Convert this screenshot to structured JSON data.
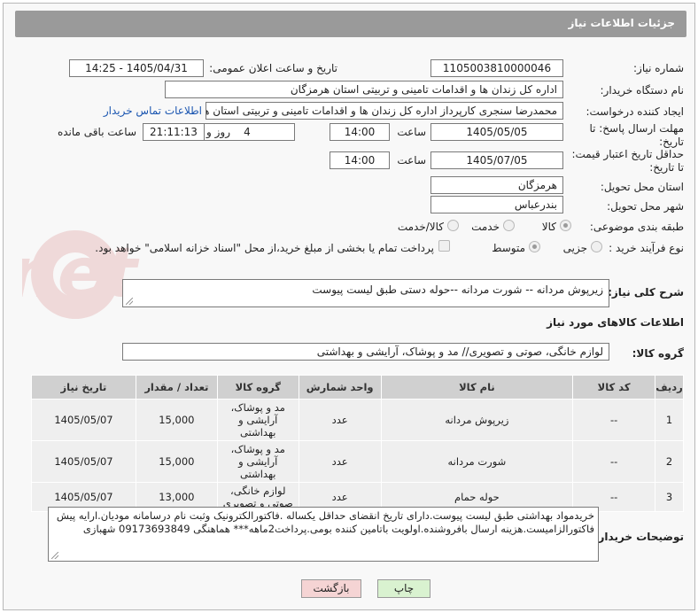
{
  "header": {
    "title": "جزئیات اطلاعات نیاز"
  },
  "form": {
    "need_number_label": "شماره نیاز:",
    "need_number": "1105003810000046",
    "announce_label": "تاریخ و ساعت اعلان عمومی:",
    "announce_value": "1405/04/31 - 14:25",
    "buyer_org_label": "نام دستگاه خریدار:",
    "buyer_org": "اداره کل زندان ها و اقدامات تامینی و تربیتی استان هرمزگان",
    "creator_label": "ایجاد کننده درخواست:",
    "creator": "محمدرضا سنجری کارپرداز اداره کل زندان ها و اقدامات تامینی و تربیتی استان هر",
    "contact_link": "اطلاعات تماس خریدار",
    "send_deadline_label_1": "مهلت ارسال پاسخ: تا",
    "send_deadline_label_2": "تاریخ:",
    "send_date": "1405/05/05",
    "time_label": "ساعت",
    "send_time": "14:00",
    "days_value": "4",
    "days_label": "روز و",
    "remaining_time": "21:11:13",
    "remaining_label": "ساعت باقی مانده",
    "validity_label_1": "حداقل تاریخ اعتبار قیمت:",
    "validity_label_2": "تا تاریخ:",
    "validity_date": "1405/07/05",
    "validity_time": "14:00",
    "province_label": "استان محل تحویل:",
    "province": "هرمزگان",
    "city_label": "شهر محل تحویل:",
    "city": "بندرعباس",
    "category_label": "طبقه بندی موضوعی:",
    "category_options": [
      "کالا",
      "خدمت",
      "کالا/خدمت"
    ],
    "purchase_type_label": "نوع فرآیند خرید :",
    "purchase_options": [
      "جزیی",
      "متوسط"
    ],
    "payment_note": "پرداخت تمام یا بخشی از مبلغ خرید،از محل \"اسناد خزانه اسلامی\" خواهد بود.",
    "description_label": "شرح کلی نیاز:",
    "description": "زیرپوش مردانه -- شورت مردانه --حوله دستی طبق لیست پیوست",
    "goods_info_title": "اطلاعات کالاهای مورد نیاز",
    "goods_group_label": "گروه کالا:",
    "goods_group": "لوازم خانگی، صوتی و تصویری// مد و پوشاک، آرایشی و بهداشتی"
  },
  "table": {
    "headers": [
      "ردیف",
      "کد کالا",
      "نام کالا",
      "واحد شمارش",
      "گروه کالا",
      "تعداد / مقدار",
      "تاریخ نیاز"
    ],
    "rows": [
      [
        "1",
        "--",
        "زیرپوش مردانه",
        "عدد",
        "مد و پوشاک، آرایشی و بهداشتی",
        "15,000",
        "1405/05/07"
      ],
      [
        "2",
        "--",
        "شورت مردانه",
        "عدد",
        "مد و پوشاک، آرایشی و بهداشتی",
        "15,000",
        "1405/05/07"
      ],
      [
        "3",
        "--",
        "حوله حمام",
        "عدد",
        "لوازم خانگی، صوتی و تصویری",
        "13,000",
        "1405/05/07"
      ]
    ]
  },
  "buyer_notes_label": "توضیحات خریدار:",
  "buyer_notes": "خریدمواد بهداشتی طبق لیست پیوست.دارای تاریخ انقضای حداقل یکساله .فاکتورالکترونیک وثبت نام درسامانه مودیان.ارایه پیش فاکتورالزامیست.هزینه ارسال بافروشنده.اولویت باتامین کننده بومی.پرداخت2ماهه*** هماهنگی 09173693849 شهبازی",
  "buttons": {
    "print": "چاپ",
    "back": "بازگشت"
  },
  "watermark_text": "AriaTender.net",
  "colors": {
    "header_bg": "#9a9a9a",
    "link": "#1a55b0",
    "print_btn": "#d9f2d0",
    "back_btn": "#f5d4d4"
  }
}
